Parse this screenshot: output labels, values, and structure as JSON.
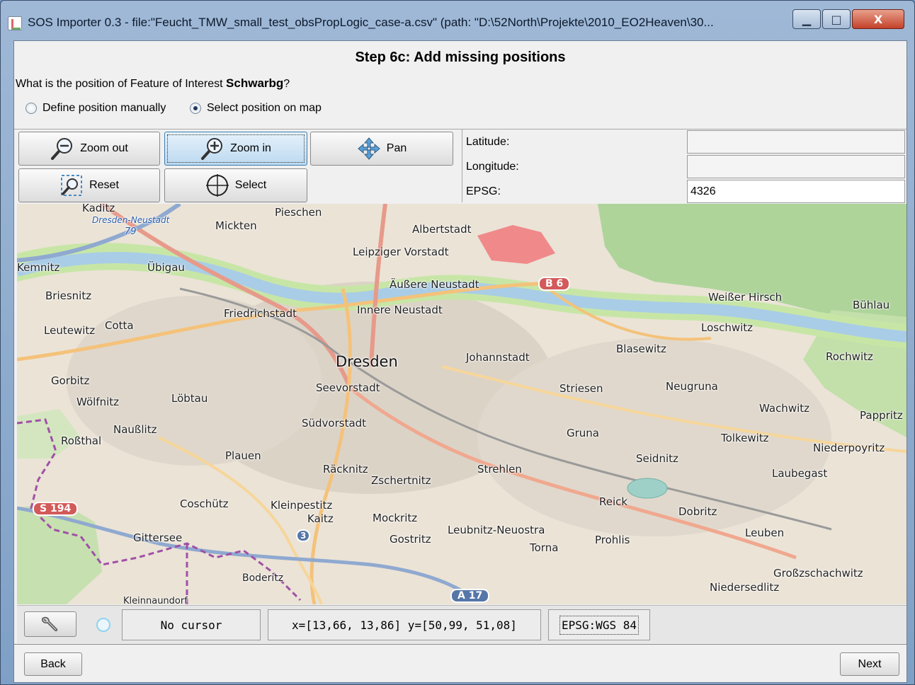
{
  "window": {
    "title": "SOS Importer 0.3 - file:\"Feucht_TMW_small_test_obsPropLogic_case-a.csv\" (path: \"D:\\52North\\Projekte\\2010_EO2Heaven\\30...",
    "min_glyph": "▁",
    "max_glyph": "□",
    "close_glyph": "X"
  },
  "step": {
    "title": "Step 6c: Add missing positions",
    "question_prefix": "What is the position of Feature of Interest",
    "feature_name": "Schwarbg",
    "question_suffix": "?"
  },
  "position_options": [
    {
      "label": "Define position manually",
      "selected": false
    },
    {
      "label": "Select position on map",
      "selected": true
    }
  ],
  "toolbar": {
    "zoom_out": "Zoom out",
    "zoom_in": "Zoom in",
    "pan": "Pan",
    "reset": "Reset",
    "select": "Select"
  },
  "coordinates": {
    "latitude_label": "Latitude:",
    "latitude_value": "",
    "longitude_label": "Longitude:",
    "longitude_value": "",
    "epsg_label": "EPSG:",
    "epsg_value": "4326"
  },
  "map": {
    "places": {
      "kaditz": "Kaditz",
      "dresden_neustadt": "Dresden-Neustadt",
      "n79": "79",
      "pieschen": "Pieschen",
      "mickten": "Mickten",
      "albertstadt": "Albertstadt",
      "leipziger_vorstadt": "Leipziger Vorstadt",
      "kemnitz": "Kemnitz",
      "ubigau": "Übigau",
      "aussere_neustadt": "Äußere Neustadt",
      "briesnitz": "Briesnitz",
      "friedrichstadt": "Friedrichstadt",
      "innere_neustadt": "Innere Neustadt",
      "weisser_hirsch": "Weißer Hirsch",
      "buhlau": "Bühlau",
      "leutewitz": "Leutewitz",
      "cotta": "Cotta",
      "loschwitz": "Loschwitz",
      "blasewitz": "Blasewitz",
      "johannstadt": "Johannstadt",
      "rochwitz": "Rochwitz",
      "dresden": "Dresden",
      "gorbitz": "Gorbitz",
      "seevorstadt": "Seevorstadt",
      "striesen": "Striesen",
      "neugruna": "Neugruna",
      "wolfnitz": "Wölfnitz",
      "lobtau": "Löbtau",
      "wachwitz": "Wachwitz",
      "pappritz": "Pappritz",
      "naussnitz": "Naußlitz",
      "sudvorstadt": "Südvorstadt",
      "rossthal": "Roßthal",
      "gruna": "Gruna",
      "tolkewitz": "Tolkewitz",
      "niederpoyritz": "Niederpoyritz",
      "plauen": "Plauen",
      "seidnitz": "Seidnitz",
      "racknitz": "Räcknitz",
      "strehlen": "Strehlen",
      "zschertnitz": "Zschertnitz",
      "laubegast": "Laubegast",
      "coschutz": "Coschütz",
      "kleinpestitz": "Kleinpestitz",
      "reick": "Reick",
      "dobritz": "Dobritz",
      "kaitz": "Kaitz",
      "mockritz": "Mockritz",
      "gittersee": "Gittersee",
      "leubnitz": "Leubnitz-Neuostra",
      "leuben": "Leuben",
      "gostritz": "Gostritz",
      "torna": "Torna",
      "prohlis": "Prohlis",
      "boderitz": "Boderitz",
      "grossschachwitz": "Großzschachwitz",
      "niedersedlitz": "Niedersedlitz",
      "kleinnaundorf": "Kleinnaundorf"
    },
    "shields": {
      "b6": "B 6",
      "s194": "S 194",
      "a17": "A 17",
      "e3": "3"
    }
  },
  "status": {
    "cursor": "No cursor",
    "extent": "x=[13,66, 13,86] y=[50,99, 51,08]",
    "crs": "EPSG:WGS 84"
  },
  "nav": {
    "back": "Back",
    "next": "Next"
  }
}
